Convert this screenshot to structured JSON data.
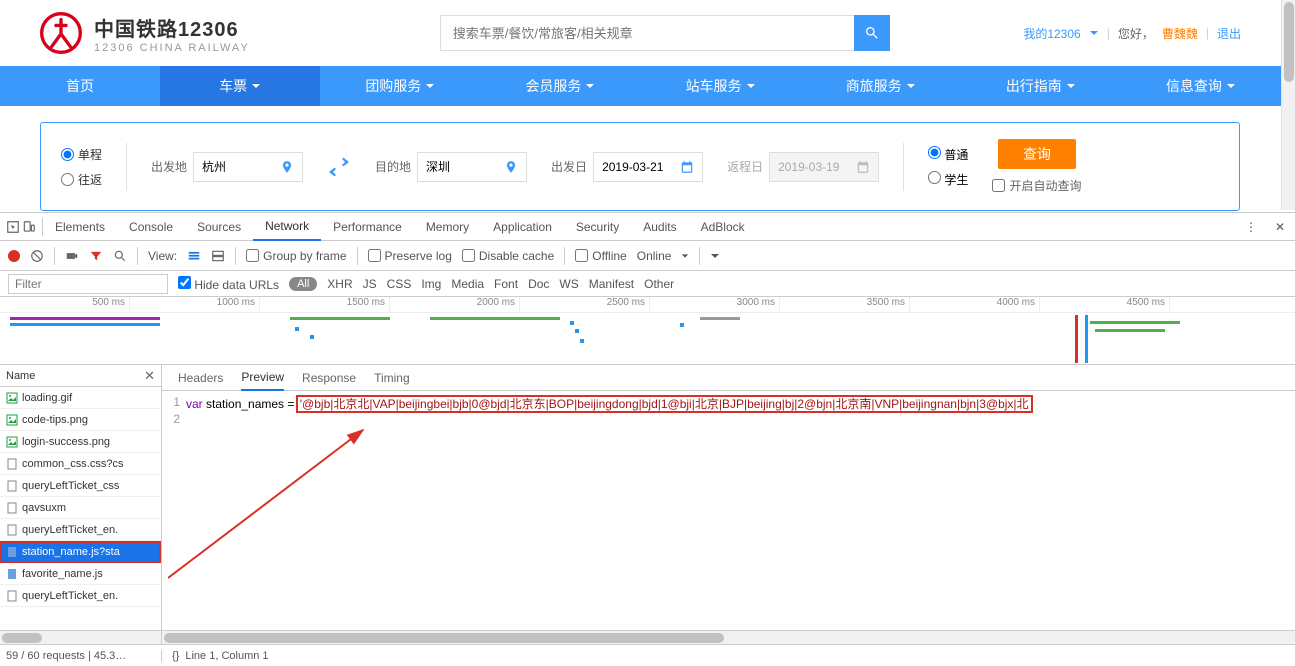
{
  "header": {
    "logo_cn": "中国铁路12306",
    "logo_en": "12306 CHINA RAILWAY",
    "search_placeholder": "搜索车票/餐饮/常旅客/相关规章",
    "my_link": "我的12306",
    "greeting": "您好，",
    "username": "曹魏魏",
    "logout": "退出"
  },
  "nav": {
    "items": [
      "首页",
      "车票",
      "团购服务",
      "会员服务",
      "站车服务",
      "商旅服务",
      "出行指南",
      "信息查询"
    ]
  },
  "search_panel": {
    "trip_one": "单程",
    "trip_round": "往返",
    "from_label": "出发地",
    "from_value": "杭州",
    "to_label": "目的地",
    "to_value": "深圳",
    "depart_label": "出发日",
    "depart_value": "2019-03-21",
    "return_label": "返程日",
    "return_value": "2019-03-19",
    "seat_normal": "普通",
    "seat_student": "学生",
    "query_btn": "查询",
    "auto_query": "开启自动查询"
  },
  "devtools": {
    "tabs": [
      "Elements",
      "Console",
      "Sources",
      "Network",
      "Performance",
      "Memory",
      "Application",
      "Security",
      "Audits",
      "AdBlock"
    ],
    "toolbar": {
      "view": "View:",
      "group_frame": "Group by frame",
      "preserve_log": "Preserve log",
      "disable_cache": "Disable cache",
      "offline": "Offline",
      "online": "Online"
    },
    "filter": {
      "placeholder": "Filter",
      "hide_urls": "Hide data URLs",
      "all": "All",
      "types": [
        "XHR",
        "JS",
        "CSS",
        "Img",
        "Media",
        "Font",
        "Doc",
        "WS",
        "Manifest",
        "Other"
      ]
    },
    "waterfall_ticks": [
      "500 ms",
      "1000 ms",
      "1500 ms",
      "2000 ms",
      "2500 ms",
      "3000 ms",
      "3500 ms",
      "4000 ms",
      "4500 ms"
    ],
    "list_header": "Name",
    "files": [
      {
        "name": "loading.gif",
        "type": "img"
      },
      {
        "name": "code-tips.png",
        "type": "img"
      },
      {
        "name": "login-success.png",
        "type": "img"
      },
      {
        "name": "common_css.css?cs",
        "type": "css"
      },
      {
        "name": "queryLeftTicket_css",
        "type": "css"
      },
      {
        "name": "qavsuxm",
        "type": "other"
      },
      {
        "name": "queryLeftTicket_en.",
        "type": "other"
      },
      {
        "name": "station_name.js?sta",
        "type": "js",
        "selected": true,
        "highlighted": true
      },
      {
        "name": "favorite_name.js",
        "type": "js"
      },
      {
        "name": "queryLeftTicket_en.",
        "type": "other"
      }
    ],
    "detail_tabs": [
      "Headers",
      "Preview",
      "Response",
      "Timing"
    ],
    "code": {
      "line1_kw": "var",
      "line1_var": " station_names =",
      "line1_str": "'@bjb|北京北|VAP|beijingbei|bjb|0@bjd|北京东|BOP|beijingdong|bjd|1@bji|北京|BJP|beijing|bj|2@bjn|北京南|VNP|beijingnan|bjn|3@bjx|北"
    },
    "status_left": "59 / 60 requests | 45.3…",
    "status_right": "Line 1, Column 1"
  }
}
